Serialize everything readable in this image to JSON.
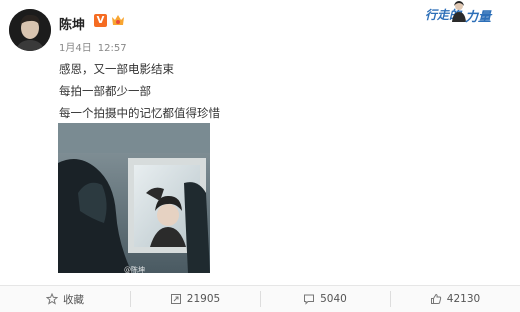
{
  "post": {
    "username": "陈坤",
    "verified_mark": "V",
    "date": "1月4日",
    "time": "12:57",
    "lines": [
      "感恩，又一部电影结束",
      "每拍一部都少一部",
      "每一个拍摄中的记忆都值得珍惜"
    ],
    "watermark": "@陈坤"
  },
  "corner_promo": {
    "text_left": "行走的",
    "text_right": "力量"
  },
  "toolbar": {
    "favorite_label": "收藏",
    "repost_count": "21905",
    "comment_count": "5040",
    "like_count": "42130"
  },
  "colors": {
    "verified_badge": "#f56c22",
    "promo_blue": "#2d6fb8",
    "toolbar_bg": "#fafafa"
  },
  "icons": [
    "star-icon",
    "repost-icon",
    "comment-icon",
    "like-icon"
  ]
}
